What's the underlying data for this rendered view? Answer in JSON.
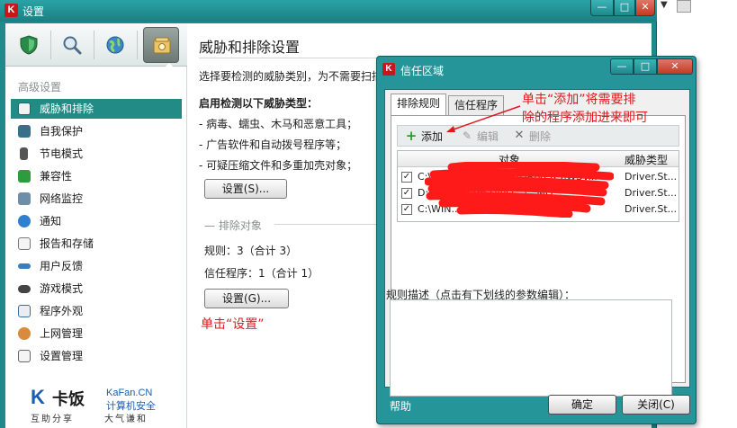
{
  "main_window": {
    "title": "设置",
    "logo_letter": "K",
    "minimize_glyph": "—",
    "maximize_glyph": "□",
    "close_glyph": "✕"
  },
  "toolbar": {
    "icons": [
      "shield-icon",
      "magnifier-icon",
      "globe-icon",
      "safe-icon"
    ],
    "selected": "safe-icon"
  },
  "sidebar": {
    "heading": "高级设置",
    "items": [
      {
        "label": "威胁和排除",
        "icon": "threat-icon",
        "selected": true
      },
      {
        "label": "自我保护",
        "icon": "self-defense-icon"
      },
      {
        "label": "节电模式",
        "icon": "battery-icon"
      },
      {
        "label": "兼容性",
        "icon": "compatibility-icon"
      },
      {
        "label": "网络监控",
        "icon": "network-icon"
      },
      {
        "label": "通知",
        "icon": "info-icon"
      },
      {
        "label": "报告和存储",
        "icon": "report-icon"
      },
      {
        "label": "用户反馈",
        "icon": "feedback-icon"
      },
      {
        "label": "游戏模式",
        "icon": "gamepad-icon"
      },
      {
        "label": "程序外观",
        "icon": "appearance-icon"
      },
      {
        "label": "上网管理",
        "icon": "parental-icon"
      },
      {
        "label": "设置管理",
        "icon": "settings-manage-icon"
      }
    ]
  },
  "logo": {
    "mark": "K",
    "name": "卡饭",
    "url": "KaFan.CN",
    "tagline1": "计算机安全",
    "slogan_left": "互助分享",
    "slogan_right": "大气谦和"
  },
  "content": {
    "title": "威胁和排除设置",
    "intro": "选择要检测的威胁类别，为不需要扫描",
    "enable_heading": "启用检测以下威胁类型：",
    "threat_lines": [
      "- 病毒、蠕虫、木马和恶意工具；",
      "- 广告软件和自动拨号程序等；",
      "- 可疑压缩文件和多重加壳对象；"
    ],
    "settings_btn1": "设置(S)...",
    "exclusions_group": "排除对象",
    "rules_line": "规则：3（合计 3）",
    "trusted_line": "信任程序：1（合计 1）",
    "settings_btn2": "设置(G)...",
    "note_click_settings": "单击“设置”"
  },
  "dialog": {
    "title": "信任区域",
    "logo_letter": "K",
    "minimize_glyph": "—",
    "maximize_glyph": "□",
    "close_glyph": "✕",
    "tabs": [
      "排除规则",
      "信任程序"
    ],
    "active_tab": 0,
    "actions": {
      "add": "添加",
      "edit": "编辑",
      "delete": "删除"
    },
    "table": {
      "columns": [
        "对象",
        "威胁类型"
      ],
      "rows": [
        {
          "checked": true,
          "object": "C:\\WIN...\\SYSTEM32\\DRIVERS\\WSV...",
          "threat": "Driver.St..."
        },
        {
          "checked": true,
          "object": "D:\\...\\Program Files\\...\\...MG...",
          "threat": "Driver.St..."
        },
        {
          "checked": true,
          "object": "C:\\WIN...\\SYSTEM32\\...\\SYS",
          "threat": "Driver.St..."
        }
      ]
    },
    "desc_label": "规则描述（点击有下划线的参数编辑）：",
    "help": "帮助",
    "ok": "确定",
    "close": "关闭(C)"
  },
  "annotation": {
    "line1": "单击“添加”将需要排",
    "line2": "除的程序添加进来即可",
    "color": "#e0181d"
  },
  "edge": {
    "dropdown_glyph": "▼"
  }
}
